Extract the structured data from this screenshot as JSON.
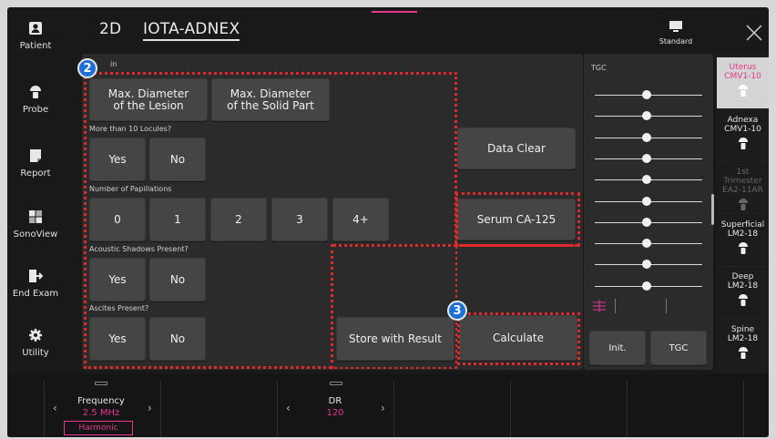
{
  "nav": {
    "items": [
      {
        "label": "Patient"
      },
      {
        "label": "Probe"
      },
      {
        "label": "Report"
      },
      {
        "label": "SonoView"
      },
      {
        "label": "End Exam"
      },
      {
        "label": "Utility"
      }
    ]
  },
  "header": {
    "mode": "2D",
    "title": "IOTA-ADNEX",
    "preset_label": "Standard"
  },
  "panel": {
    "section_label_partial": "in",
    "max_diameter_lesion": "Max. Diameter\nof the Lesion",
    "max_diameter_solid": "Max. Diameter\nof the Solid Part",
    "q_locules": "More than 10 Locules?",
    "q_papillations": "Number of Papillations",
    "q_acoustic": "Acoustic Shadows Present?",
    "q_ascites": "Ascites Present?",
    "yes": "Yes",
    "no": "No",
    "papillations": [
      "0",
      "1",
      "2",
      "3",
      "4+"
    ],
    "data_clear": "Data Clear",
    "serum": "Serum CA-125",
    "store": "Store with Result",
    "calculate": "Calculate"
  },
  "badges": {
    "two": "2",
    "three": "3"
  },
  "tgc": {
    "label": "TGC",
    "init": "Init.",
    "tgc_button": "TGC"
  },
  "probes": [
    {
      "name": "Uterus",
      "model": "CMV1-10",
      "state": "active"
    },
    {
      "name": "Adnexa",
      "model": "CMV1-10",
      "state": "normal"
    },
    {
      "name": "1st Trimester",
      "model": "EA2-11AR",
      "state": "disabled"
    },
    {
      "name": "Superficial",
      "model": "LM2-18",
      "state": "normal"
    },
    {
      "name": "Deep",
      "model": "LM2-18",
      "state": "normal"
    },
    {
      "name": "Spine",
      "model": "LM2-18",
      "state": "normal"
    }
  ],
  "bottom": {
    "frequency_label": "Frequency",
    "frequency_value": "2.5 MHz",
    "harmonic": "Harmonic",
    "dr_label": "DR",
    "dr_value": "120"
  },
  "colors": {
    "accent": "#e8358e",
    "annotation_red": "#e02a2a",
    "badge_blue": "#1f6fd8"
  }
}
